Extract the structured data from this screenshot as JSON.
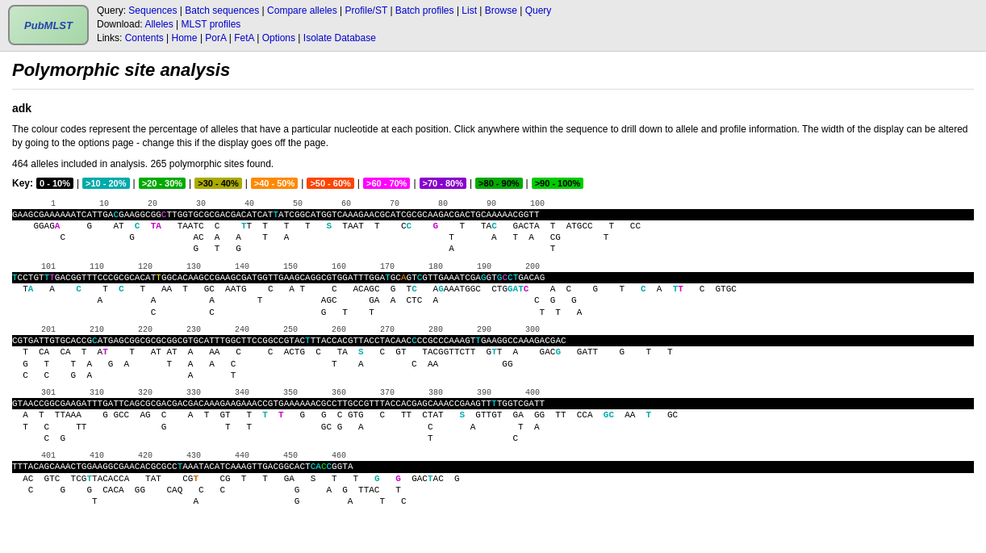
{
  "header": {
    "logo_text": "PubMLST",
    "query_label": "Query:",
    "download_label": "Download:",
    "links_label": "Links:",
    "query_links": [
      {
        "label": "Sequences",
        "href": "#"
      },
      {
        "label": "Batch sequences",
        "href": "#"
      },
      {
        "label": "Compare alleles",
        "href": "#"
      },
      {
        "label": "Profile/ST",
        "href": "#"
      },
      {
        "label": "Batch profiles",
        "href": "#"
      },
      {
        "label": "List",
        "href": "#"
      },
      {
        "label": "Browse",
        "href": "#"
      },
      {
        "label": "Query",
        "href": "#"
      }
    ],
    "download_links": [
      {
        "label": "Alleles",
        "href": "#"
      },
      {
        "label": "MLST profiles",
        "href": "#"
      }
    ],
    "nav_links": [
      {
        "label": "Contents",
        "href": "#"
      },
      {
        "label": "Home",
        "href": "#"
      },
      {
        "label": "PorA",
        "href": "#"
      },
      {
        "label": "FetA",
        "href": "#"
      },
      {
        "label": "Options",
        "href": "#"
      },
      {
        "label": "Isolate Database",
        "href": "#"
      }
    ]
  },
  "page": {
    "title": "Polymorphic site analysis",
    "gene": "adk",
    "description": "The colour codes represent the percentage of alleles that have a particular nucleotide at each position. Click anywhere within the sequence to drill down to allele and profile information. The width of the display can be altered by going to the options page - change this if the display goes off the page.",
    "stats": "464 alleles included in analysis. 265 polymorphic sites found.",
    "key": {
      "label": "Key:",
      "items": [
        {
          "label": "0 - 10%",
          "class": "k0"
        },
        {
          "label": ">10 - 20%",
          "class": "k1"
        },
        {
          "label": ">20 - 30%",
          "class": "k2"
        },
        {
          "label": ">30 - 40%",
          "class": "k3"
        },
        {
          "label": ">40 - 50%",
          "class": "k4"
        },
        {
          "label": ">50 - 60%",
          "class": "k5"
        },
        {
          "label": ">60 - 70%",
          "class": "k6"
        },
        {
          "label": ">70 - 80%",
          "class": "k7"
        },
        {
          "label": ">80 - 90%",
          "class": "k8"
        },
        {
          "label": ">90 - 100%",
          "class": "k8"
        }
      ]
    }
  }
}
